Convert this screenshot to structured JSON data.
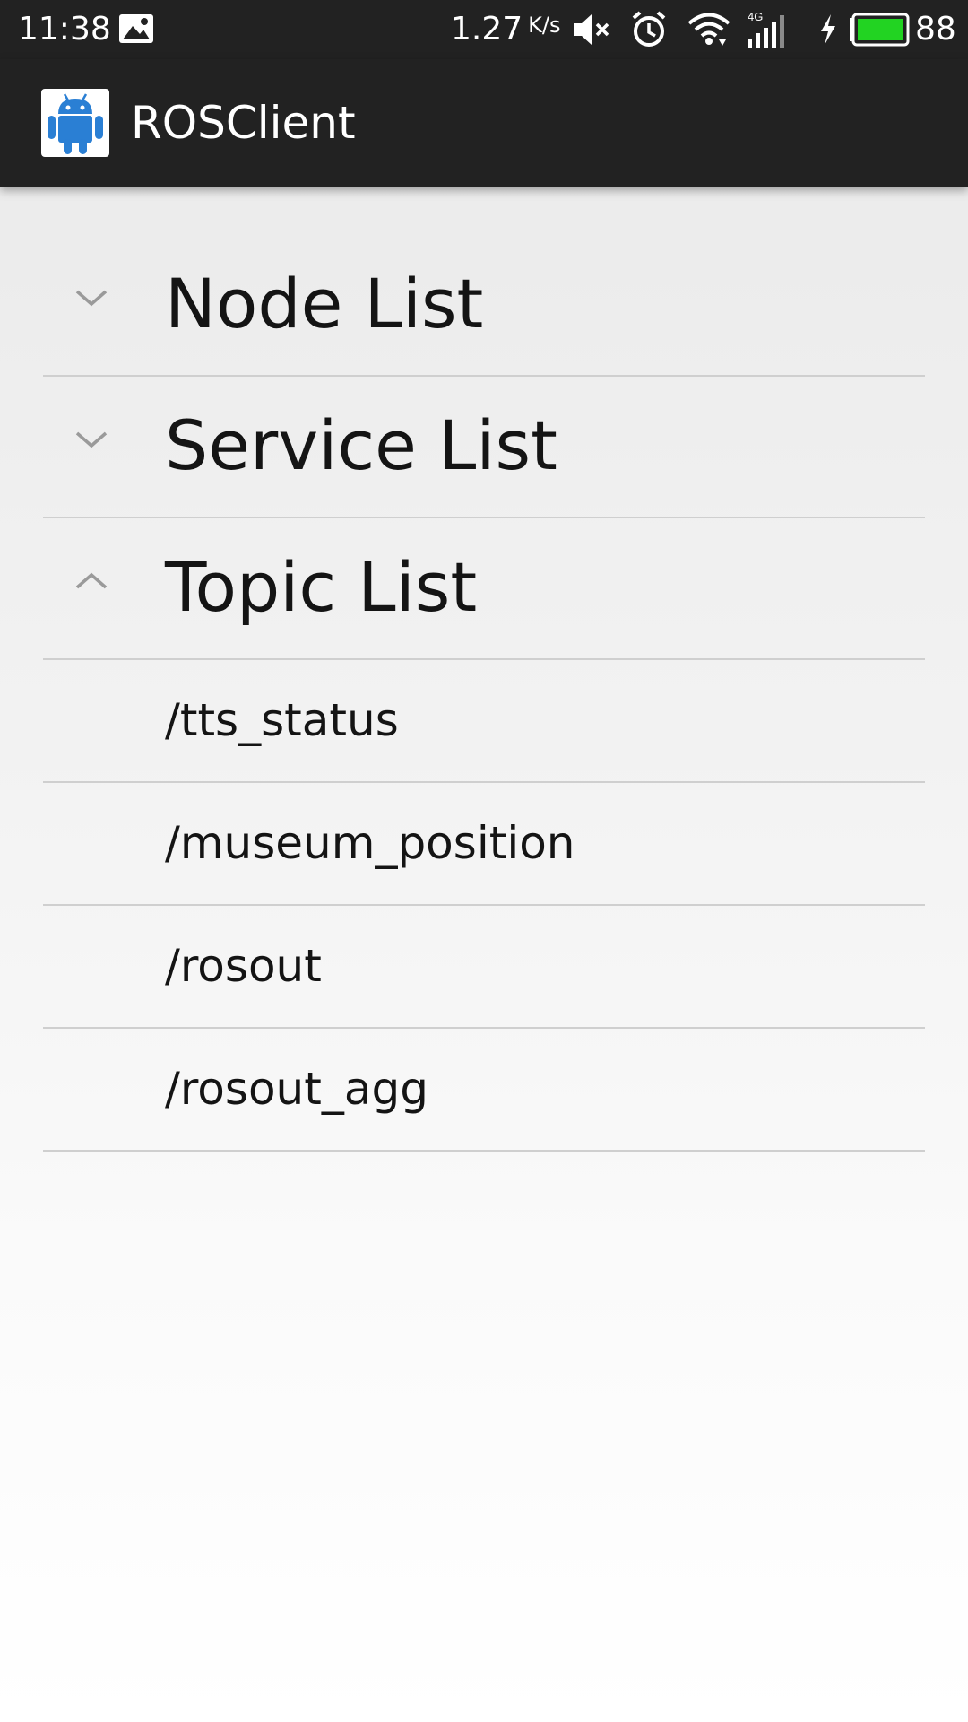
{
  "status_bar": {
    "time": "11:38",
    "network_speed": "1.27",
    "network_speed_unit": "K/s",
    "network_type": "4G",
    "battery_percent": "88",
    "icons": [
      "gallery-icon",
      "mute-icon",
      "alarm-icon",
      "wifi-icon",
      "signal-icon",
      "charging-icon",
      "battery-icon"
    ],
    "battery_color": "#22d322"
  },
  "action_bar": {
    "title": "ROSClient",
    "logo_icon": "android-icon",
    "logo_color": "#2a7fd4"
  },
  "list": {
    "groups": [
      {
        "label": "Node List",
        "expanded": false,
        "indicator_icon": "chevron-down-icon"
      },
      {
        "label": "Service List",
        "expanded": false,
        "indicator_icon": "chevron-down-icon"
      },
      {
        "label": "Topic List",
        "expanded": true,
        "indicator_icon": "chevron-up-icon",
        "children": [
          "/tts_status",
          "/museum_position",
          "/rosout",
          "/rosout_agg"
        ]
      }
    ]
  },
  "colors": {
    "bar_background": "#222222",
    "divider": "#cfcfcf",
    "text": "#141414",
    "indicator": "#9a9a9a"
  }
}
